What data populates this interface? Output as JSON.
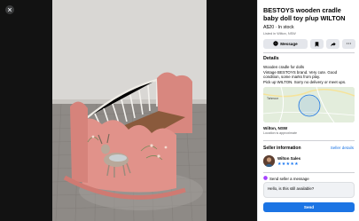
{
  "listing": {
    "title": "BESTOYS wooden cradle baby doll toy p/up WILTON",
    "price": "A$20 · In stock",
    "listed": "Listed in Wilton, NSW"
  },
  "actions": {
    "message_label": "Message",
    "more_label": "···"
  },
  "details": {
    "heading": "Details",
    "description_lines": [
      "Wooden cradle for dolls",
      "Vintage BESTOYS brand. Very cute. Good condition, some marks from play.",
      "Pick up WILTON. Sorry no delivery or meet ups."
    ]
  },
  "map": {
    "label": "Tahmoor"
  },
  "location": {
    "name": "Wilton, NSW",
    "note": "Location is approximate"
  },
  "seller": {
    "heading": "Seller information",
    "details_link": "Seller details",
    "name": "Wilton Sales",
    "stars": "★★★★★"
  },
  "contact": {
    "heading": "Send seller a message",
    "message_value": "Hello, is this still available?",
    "send_label": "Send"
  },
  "colors": {
    "accent": "#1b74e4",
    "viewer_bg": "#121212"
  },
  "icons": {
    "close": "close-icon",
    "message": "messenger-icon",
    "bookmark": "bookmark-icon",
    "share": "share-icon",
    "more": "more-icon"
  }
}
